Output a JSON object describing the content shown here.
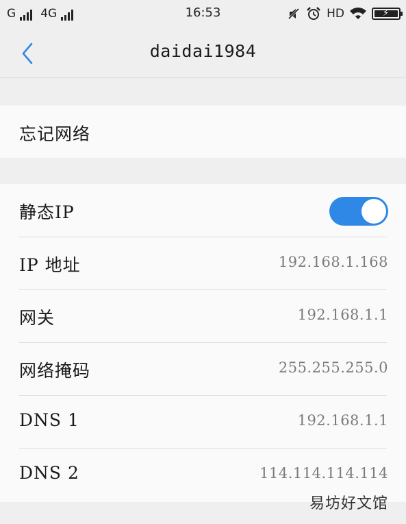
{
  "status_bar": {
    "carrier1": "G",
    "carrier2": "4G",
    "time": "16:53",
    "hd": "HD",
    "icons": [
      "mute-icon",
      "alarm-icon",
      "wifi-icon",
      "battery-charging-icon"
    ]
  },
  "nav": {
    "title": "daidai1984",
    "back_icon": "chevron-left-icon"
  },
  "forget": {
    "label": "忘记网络"
  },
  "static_ip": {
    "label": "静态IP",
    "enabled": true,
    "toggle_color": "#2f87e6"
  },
  "fields": [
    {
      "label": "IP 地址",
      "value": "192.168.1.168"
    },
    {
      "label": "网关",
      "value": "192.168.1.1"
    },
    {
      "label": "网络掩码",
      "value": "255.255.255.0"
    },
    {
      "label": "DNS 1",
      "value": "192.168.1.1"
    },
    {
      "label": "DNS 2",
      "value": "114.114.114.114"
    }
  ],
  "watermark": "易坊好文馆",
  "colors": {
    "accent": "#2f87e6",
    "background": "#efefef",
    "card": "#fafafa"
  }
}
